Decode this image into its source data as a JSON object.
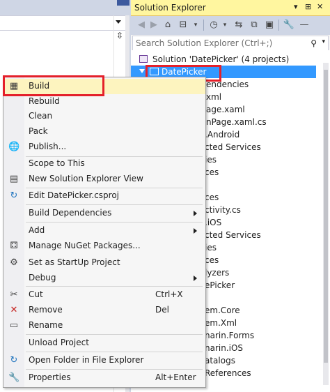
{
  "solution_explorer": {
    "title": "Solution Explorer",
    "title_controls": [
      "▾",
      "⊞",
      "✕"
    ],
    "toolbar_icons": [
      "back-icon",
      "forward-icon",
      "home-icon",
      "switch-views-icon",
      "history-icon",
      "sync-icon",
      "collapse-all-icon",
      "show-all-files-icon",
      "properties-icon",
      "preview-icon"
    ],
    "search_placeholder": "Search Solution Explorer (Ctrl+;)",
    "tree": {
      "solution": "Solution 'DatePicker' (4 projects)",
      "selected_project": "DatePicker",
      "fragments": [
        "endencies",
        "xml",
        "age.xaml",
        "nPage.xaml.cs",
        ".Android",
        "cted Services",
        "ies",
        "ces",
        "",
        "ces",
        "ctivity.cs",
        ".iOS",
        "cted Services",
        "ies",
        "ces",
        "lyzers",
        "ePicker",
        "em.Core",
        "em.Xml",
        "narin.Forms",
        "narin.iOS",
        "atalogs",
        "References"
      ]
    }
  },
  "context_menu": {
    "items": [
      {
        "label": "Build",
        "shortcut": "",
        "submenu": false,
        "icon": "build-icon"
      },
      {
        "label": "Rebuild",
        "shortcut": "",
        "submenu": false,
        "icon": ""
      },
      {
        "label": "Clean",
        "shortcut": "",
        "submenu": false,
        "icon": ""
      },
      {
        "label": "Pack",
        "shortcut": "",
        "submenu": false,
        "icon": ""
      },
      {
        "label": "Publish...",
        "shortcut": "",
        "submenu": false,
        "icon": "globe-icon"
      },
      {
        "label": "Scope to This",
        "shortcut": "",
        "submenu": false,
        "icon": ""
      },
      {
        "label": "New Solution Explorer View",
        "shortcut": "",
        "submenu": false,
        "icon": "new-view-icon"
      },
      {
        "label": "Edit DatePicker.csproj",
        "shortcut": "",
        "submenu": false,
        "icon": "edit-refresh-icon"
      },
      {
        "label": "Build Dependencies",
        "shortcut": "",
        "submenu": true,
        "icon": ""
      },
      {
        "label": "Add",
        "shortcut": "",
        "submenu": true,
        "icon": ""
      },
      {
        "label": "Manage NuGet Packages...",
        "shortcut": "",
        "submenu": false,
        "icon": "nuget-icon"
      },
      {
        "label": "Set as StartUp Project",
        "shortcut": "",
        "submenu": false,
        "icon": "gear-icon"
      },
      {
        "label": "Debug",
        "shortcut": "",
        "submenu": true,
        "icon": ""
      },
      {
        "label": "Cut",
        "shortcut": "Ctrl+X",
        "submenu": false,
        "icon": "scissors-icon"
      },
      {
        "label": "Remove",
        "shortcut": "Del",
        "submenu": false,
        "icon": "remove-icon"
      },
      {
        "label": "Rename",
        "shortcut": "",
        "submenu": false,
        "icon": "rename-icon"
      },
      {
        "label": "Unload Project",
        "shortcut": "",
        "submenu": false,
        "icon": ""
      },
      {
        "label": "Open Folder in File Explorer",
        "shortcut": "",
        "submenu": false,
        "icon": "open-folder-refresh-icon"
      },
      {
        "label": "Properties",
        "shortcut": "Alt+Enter",
        "submenu": false,
        "icon": "wrench-icon"
      }
    ]
  },
  "colors": {
    "title_bar": "#fff69f",
    "selection": "#3399ff",
    "menu_highlight": "#fdf4bf",
    "red_box": "#e4202a"
  }
}
